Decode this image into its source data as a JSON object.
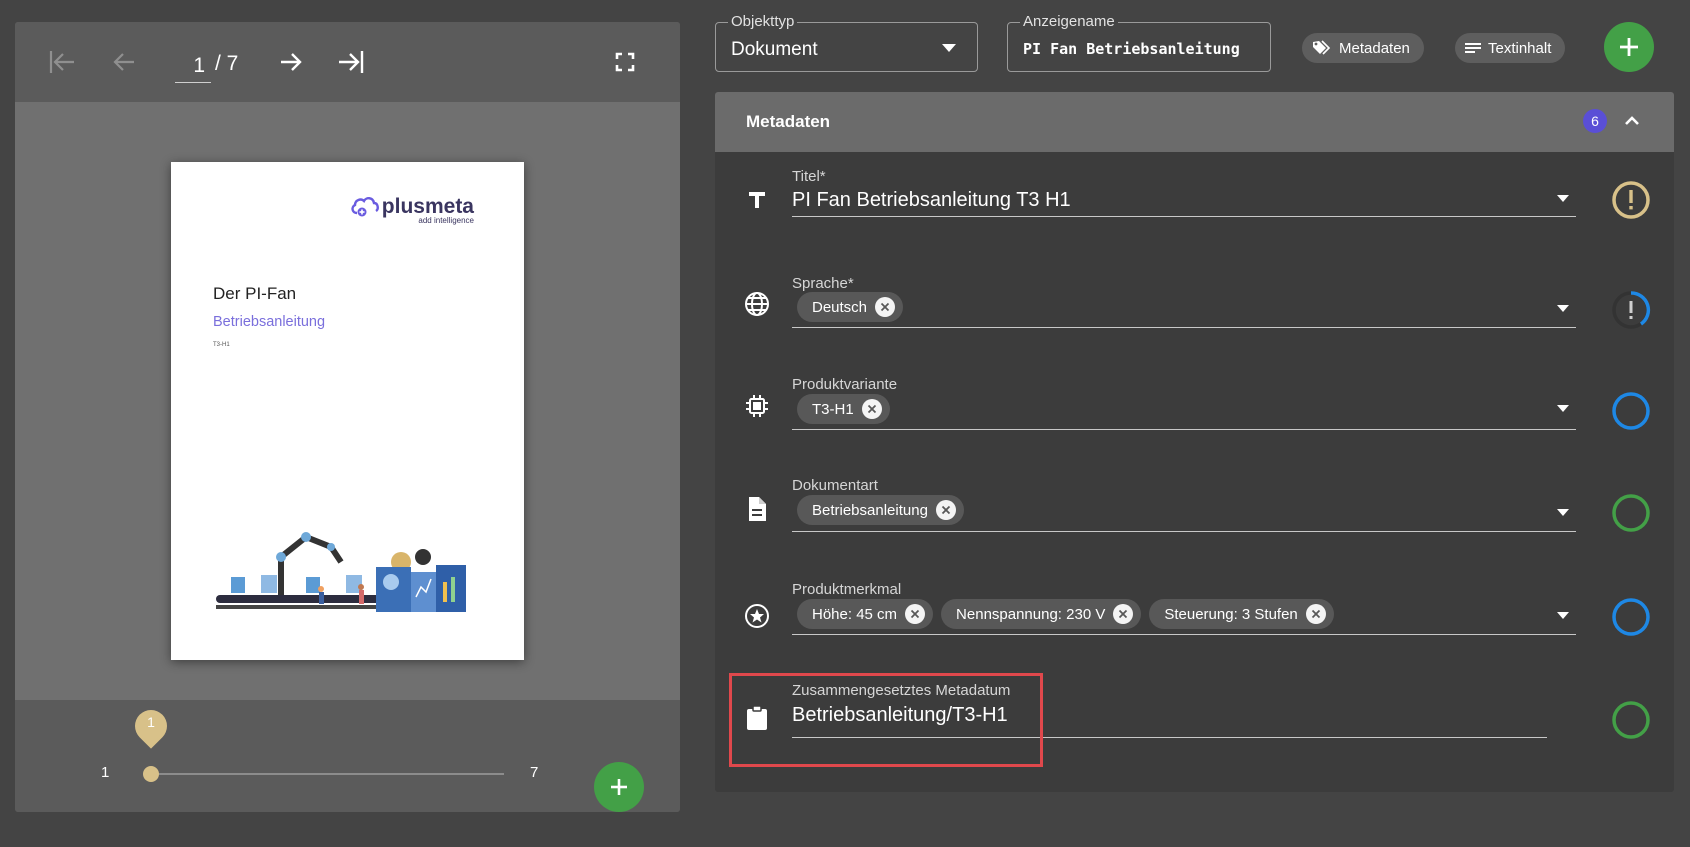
{
  "viewer": {
    "toolbar": {
      "first_icon": "first-page-icon",
      "prev_icon": "arrow-left-icon",
      "current_page": "1",
      "total_pages": "/ 7",
      "next_icon": "arrow-right-icon",
      "last_icon": "last-page-icon",
      "fullscreen_icon": "fullscreen-icon"
    },
    "document_preview": {
      "logo_text": "plusmeta",
      "logo_sub": "add intelligence",
      "heading": "Der PI-Fan",
      "subheading": "Betriebsanleitung",
      "tiny_label": "T3-H1"
    },
    "slider": {
      "min_label": "1",
      "max_label": "7",
      "value_label": "1",
      "value": 1,
      "min": 1,
      "max": 7
    },
    "add_icon": "plus-icon"
  },
  "topbar": {
    "objekttyp": {
      "label": "Objekttyp",
      "value": "Dokument"
    },
    "anzeigename": {
      "label": "Anzeigename",
      "value": "PI Fan Betriebsanleitung"
    },
    "metadaten_button": "Metadaten",
    "textinhalt_button": "Textinhalt"
  },
  "metadata": {
    "title": "Metadaten",
    "count": "6",
    "rows": [
      {
        "label": "Titel*",
        "value": "PI Fan Betriebsanleitung T3 H1",
        "icon": "text-icon",
        "status": "warning"
      },
      {
        "label": "Sprache*",
        "chips": [
          "Deutsch"
        ],
        "icon": "globe-icon",
        "status": "loading"
      },
      {
        "label": "Produktvariante",
        "chips": [
          "T3-H1"
        ],
        "icon": "chip-icon",
        "status": "blue"
      },
      {
        "label": "Dokumentart",
        "chips": [
          "Betriebsanleitung"
        ],
        "icon": "document-icon",
        "status": "green"
      },
      {
        "label": "Produktmerkmal",
        "chips": [
          "Höhe: 45 cm",
          "Nennspannung: 230 V",
          "Steuerung: 3 Stufen"
        ],
        "icon": "star-icon",
        "status": "blue"
      },
      {
        "label": "Zusammengesetztes Metadatum",
        "value": "Betriebsanleitung/T3-H1",
        "icon": "clipboard-icon",
        "status": "green"
      }
    ]
  },
  "colors": {
    "background": "#444444",
    "accent_green": "#43a047",
    "accent_purple": "#5a4fd6",
    "status_blue": "#1e88e5",
    "status_green": "#43a047",
    "status_warning": "#d8c189",
    "highlight": "#e0484c"
  }
}
